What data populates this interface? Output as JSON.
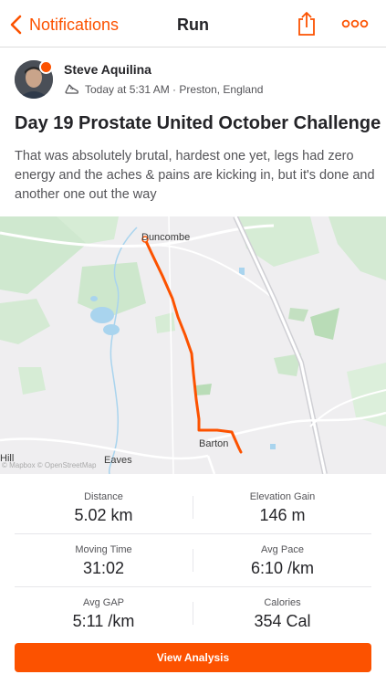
{
  "nav": {
    "back_label": "Notifications",
    "title": "Run",
    "share_icon": "share-icon",
    "more_icon": "more-icon"
  },
  "athlete": {
    "name": "Steve Aquilina",
    "avatar": "avatar",
    "activity_icon": "run-shoe-icon",
    "meta": "Today at 5:31 AM · Preston, England"
  },
  "activity": {
    "title": "Day 19 Prostate United October Challenge",
    "description": "That was absolutely brutal, hardest one yet, legs had zero energy and the aches & pains are kicking in, but it's done and another one out the way"
  },
  "map": {
    "labels": {
      "duncombe": "Duncombe",
      "barton": "Barton",
      "eaves": "Eaves",
      "hill": "Hill",
      "attribution": "© Mapbox © OpenStreetMap"
    },
    "route_color": "#fc5200"
  },
  "stats": [
    [
      {
        "label": "Distance",
        "value": "5.02 km"
      },
      {
        "label": "Elevation Gain",
        "value": "146 m"
      }
    ],
    [
      {
        "label": "Moving Time",
        "value": "31:02"
      },
      {
        "label": "Avg Pace",
        "value": "6:10 /km"
      }
    ],
    [
      {
        "label": "Avg GAP",
        "value": "5:11 /km"
      },
      {
        "label": "Calories",
        "value": "354 Cal"
      }
    ]
  ],
  "cta": {
    "label": "View Analysis"
  },
  "colors": {
    "accent": "#fc5200",
    "text": "#242428",
    "muted": "#545458"
  }
}
